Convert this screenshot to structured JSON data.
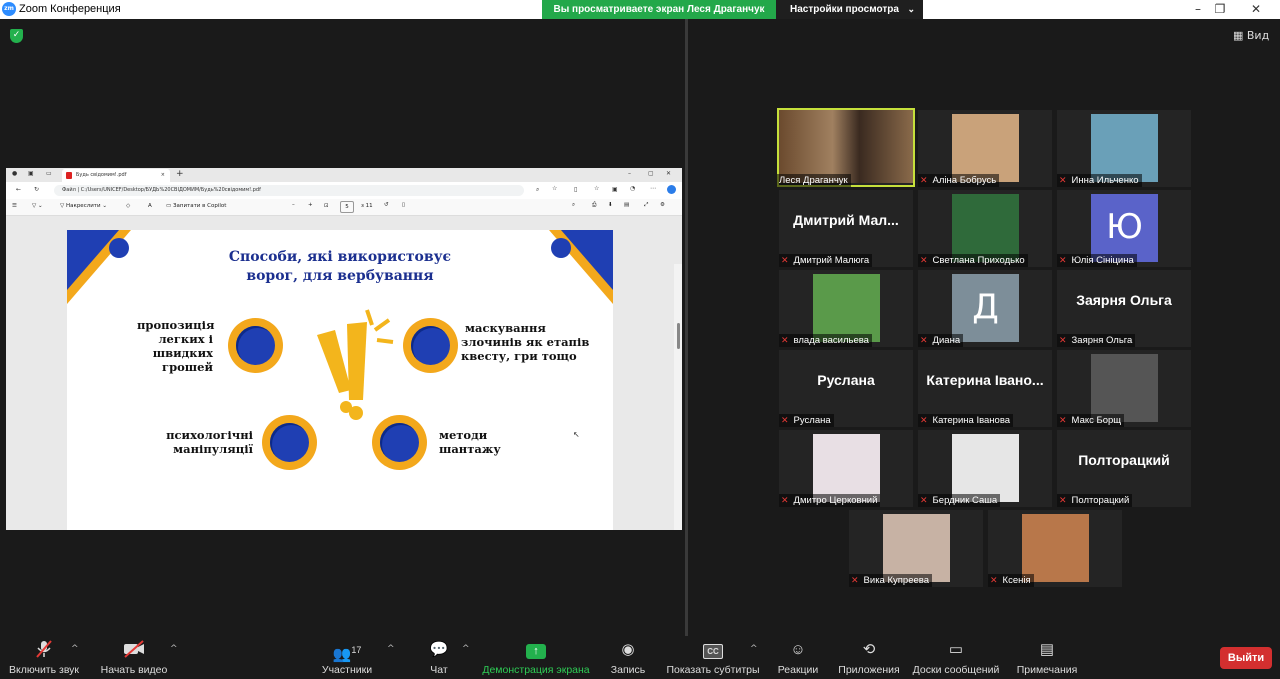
{
  "window": {
    "title": "Zoom Конференция",
    "logo": "zm"
  },
  "banner": {
    "sharing_text": "Вы просматриваете экран Леся Драганчук",
    "view_settings": "Настройки просмотра"
  },
  "view_button": "Вид",
  "shared": {
    "tab_title": "Будь свідомим!.pdf",
    "address_prefix": "Файл",
    "address": "C:/Users/UNICEF/Desktop/БУДЬ%20СВІДОМИМ/Будь%20свідомим!.pdf",
    "draw_label": "Накреслити",
    "copilot_label": "Запитати в Copilot",
    "page_num": "5",
    "page_total": "з 11",
    "slide_title_1": "Способи, які використовує",
    "slide_title_2": "ворог, для вербування",
    "item1": [
      "пропозиція",
      "легких і",
      "швидких",
      "грошей"
    ],
    "item2": [
      "маскування",
      "злочинів як етапів",
      "квесту, гри тощо"
    ],
    "item3": [
      "психологічні",
      "маніпуляції"
    ],
    "item4": [
      "методи",
      "шантажу"
    ]
  },
  "participants": [
    {
      "name": "Леся Драганчук",
      "muted": false,
      "active": true
    },
    {
      "name": "Аліна Бобрусь",
      "muted": true
    },
    {
      "name": "Инна Ильченко",
      "muted": true
    },
    {
      "name": "Дмитрий Малюга",
      "muted": true,
      "display": "Дмитрий Мал..."
    },
    {
      "name": "Светлана Приходько",
      "muted": true
    },
    {
      "name": "Юлія Сініцина",
      "muted": true,
      "initial": "Ю"
    },
    {
      "name": "влада васильева",
      "muted": true
    },
    {
      "name": "Диана",
      "muted": true,
      "initial": "Д"
    },
    {
      "name": "Заярня Ольга",
      "muted": true,
      "display": "Заярня Ольга"
    },
    {
      "name": "Руслана",
      "muted": true,
      "display": "Руслана"
    },
    {
      "name": "Катерина Іванова",
      "muted": true,
      "display": "Катерина Івано..."
    },
    {
      "name": "Макс Борщ",
      "muted": true
    },
    {
      "name": "Дмитро Церковний",
      "muted": true
    },
    {
      "name": "Бердник Саша",
      "muted": true
    },
    {
      "name": "Полторацкий",
      "muted": true,
      "display": "Полторацкий"
    },
    {
      "name": "Вика Купреева",
      "muted": true
    },
    {
      "name": "Ксенія",
      "muted": true
    }
  ],
  "toolbar": {
    "mute": "Включить звук",
    "video": "Начать видео",
    "participants": "Участники",
    "participants_count": "17",
    "chat": "Чат",
    "share": "Демонстрация экрана",
    "record": "Запись",
    "captions": "Показать субтитры",
    "captions_icon": "CC",
    "reactions": "Реакции",
    "apps": "Приложения",
    "whiteboards": "Доски сообщений",
    "notes": "Примечания",
    "leave": "Выйти"
  },
  "colors": {
    "share_green": "#23a84a",
    "leave_red": "#d32f2f",
    "slide_blue": "#1b2f8f",
    "slide_orange": "#f3a81c",
    "active_outline": "#c6e03b"
  }
}
